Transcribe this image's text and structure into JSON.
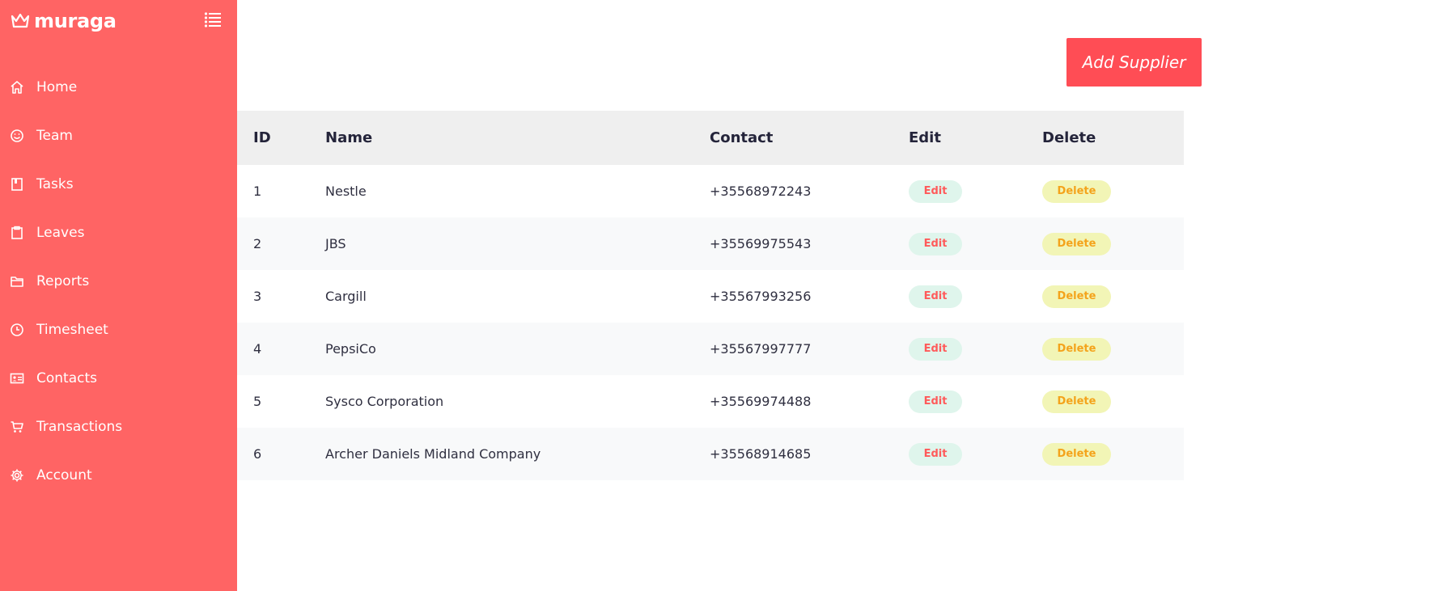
{
  "brand": {
    "name": "muraga"
  },
  "sidebar": {
    "items": [
      {
        "label": "Home",
        "icon": "home-icon"
      },
      {
        "label": "Team",
        "icon": "smile-icon"
      },
      {
        "label": "Tasks",
        "icon": "book-icon"
      },
      {
        "label": "Leaves",
        "icon": "clipboard-icon"
      },
      {
        "label": "Reports",
        "icon": "folder-icon"
      },
      {
        "label": "Timesheet",
        "icon": "clock-icon"
      },
      {
        "label": "Contacts",
        "icon": "contact-card-icon"
      },
      {
        "label": "Transactions",
        "icon": "cart-icon"
      },
      {
        "label": "Account",
        "icon": "gear-icon"
      }
    ]
  },
  "main": {
    "add_button_label": "Add Supplier",
    "table": {
      "headers": [
        "ID",
        "Name",
        "Contact",
        "Edit",
        "Delete"
      ],
      "rows": [
        {
          "id": "1",
          "name": "Nestle",
          "contact": "+35568972243",
          "edit": "Edit",
          "delete": "Delete"
        },
        {
          "id": "2",
          "name": "JBS",
          "contact": "+35569975543",
          "edit": "Edit",
          "delete": "Delete"
        },
        {
          "id": "3",
          "name": "Cargill",
          "contact": "+35567993256",
          "edit": "Edit",
          "delete": "Delete"
        },
        {
          "id": "4",
          "name": "PepsiCo",
          "contact": "+35567997777",
          "edit": "Edit",
          "delete": "Delete"
        },
        {
          "id": "5",
          "name": "Sysco Corporation",
          "contact": "+35569974488",
          "edit": "Edit",
          "delete": "Delete"
        },
        {
          "id": "6",
          "name": "Archer Daniels Midland Company",
          "contact": "+35568914685",
          "edit": "Edit",
          "delete": "Delete"
        }
      ]
    }
  },
  "colors": {
    "sidebar_bg": "#ff6464",
    "accent_button": "#ff4d55",
    "edit_pill_bg": "#dff5ec",
    "edit_pill_text": "#ff5a5a",
    "delete_pill_bg": "#f2f5b6",
    "delete_pill_text": "#f4a31b"
  }
}
